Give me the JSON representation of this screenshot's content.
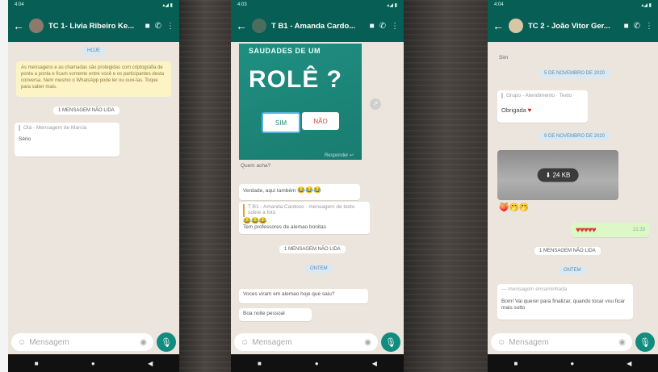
{
  "phones": [
    {
      "status": {
        "time": "4:04",
        "icons": "▴◢ ▮"
      },
      "header": {
        "title": "TC 1- Livia Ribeiro Ke..."
      },
      "messages": {
        "date_pill": "HOJE",
        "encryption": "As mensagens e as chamadas são protegidas com criptografia de ponta a ponta e ficam somente entre você e os participantes desta conversa. Nem mesmo o WhatsApp pode ler ou ouvi-las. Toque para saber mais.",
        "unread": "1 MENSAGEM NÃO LIDA",
        "quote": "Olá - Mensagem de Marcia",
        "msg": "Sério"
      }
    },
    {
      "status": {
        "time": "4:03",
        "icons": "▴◢ ▮"
      },
      "header": {
        "title": "T B1 - Amanda Cardo..."
      },
      "poll": {
        "top": "SAUDADES DE UM",
        "big": "ROLÊ ?",
        "yes": "SIM",
        "no": "NÃO",
        "foot": "Responder ↩"
      },
      "messages": {
        "after_poll": "Quem acha?",
        "reply1": "Verdade, aqui também",
        "emoji1": "😂😂😂",
        "quote": "T B1 - Amanda Cardoso · mensagem de texto sobre a foto",
        "emoji2": "😂😂😂",
        "reply2": "Tem professores de alemao bonitas",
        "unread": "1 MENSAGEM NÃO LIDA",
        "date_pill": "ONTEM",
        "msg1": "Voces viram em alemao hoje que saiu?",
        "msg2": "Boa noite pessoal"
      }
    },
    {
      "status": {
        "time": "4:04",
        "icons": "▴◢ ▮"
      },
      "header": {
        "title": "TC 2 - João Vitor Ger..."
      },
      "messages": {
        "top": "Sim",
        "pill1": "5 DE NOVEMBRO DE 2020",
        "quote": "Grupo - Atendimento · Texto",
        "thanks": "Obrigada",
        "pill2": "9 DE NOVEMBRO DE 2020",
        "video_label": "⬇ 24 KB",
        "emoji_row": "🍑🤭🤭",
        "hearts": "♥♥♥♥♥",
        "time_out": "21:33",
        "unread": "1 MENSAGEM NÃO LIDA",
        "date_pill": "ONTEM",
        "quote2": "— mensagem encaminhada",
        "msg": "Bom! Vai querer para finalizar, quando tocar vou ficar mais solto"
      }
    }
  ],
  "nav": {
    "back": "◀",
    "home": "●",
    "recent": "■"
  },
  "input": {
    "placeholder": "Mensagem"
  }
}
